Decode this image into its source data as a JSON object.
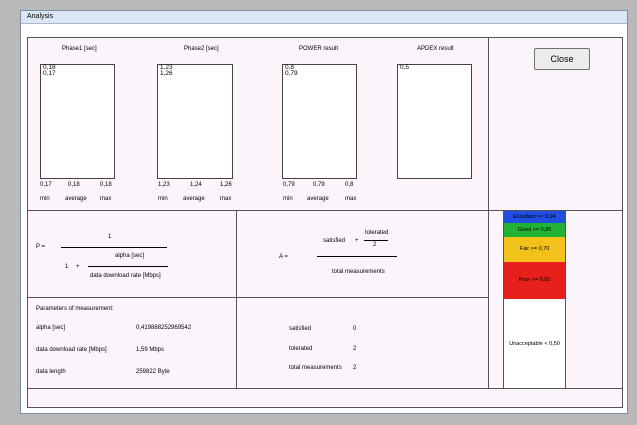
{
  "window": {
    "title": "Analysis"
  },
  "results": [
    {
      "title": "Phase1 [sec]",
      "values": [
        "0,18",
        "0,17"
      ],
      "min": "0,17",
      "average": "0,18",
      "max": "0,18"
    },
    {
      "title": "Phase2 [sec]",
      "values": [
        "1,23",
        "1,26"
      ],
      "min": "1,23",
      "average": "1,24",
      "max": "1,26"
    },
    {
      "title": "POWER result",
      "values": [
        "0,8",
        "0,79"
      ],
      "min": "0,79",
      "average": "0,79",
      "max": "0,8"
    },
    {
      "title": "APDEX result",
      "values": [
        "0,5"
      ]
    }
  ],
  "stat_labels": {
    "min": "min",
    "average": "average",
    "max": "max"
  },
  "close_label": "Close",
  "formula_p": {
    "lhs": "P =",
    "numerator": "1",
    "inner_one": "1",
    "plus": "+",
    "inner_numerator": "alpha [sec]",
    "inner_denominator": "data download rate [Mbps]"
  },
  "formula_a": {
    "lhs": "A =",
    "satisfied": "satisfied",
    "plus": "+",
    "tolerated": "tolerated",
    "two": "2",
    "denominator": "total measurements"
  },
  "parameters": {
    "title": "Parameters of measurement:",
    "rows": [
      {
        "label": "alpha [sec]",
        "value": "0,419888252969542"
      },
      {
        "label": "data download rate [Mbps]",
        "value": "1,59 Mbps"
      },
      {
        "label": "data length",
        "value": "259822 Byte"
      }
    ]
  },
  "counts": [
    {
      "label": "satisfied",
      "value": "0"
    },
    {
      "label": "tolerated",
      "value": "2"
    },
    {
      "label": "total measurements",
      "value": "2"
    }
  ],
  "apdex_scale": [
    {
      "label": "Excellent >= 0,94",
      "color": "#1f4ee0"
    },
    {
      "label": "Good >= 0,85",
      "color": "#22b233"
    },
    {
      "label": "Fair >= 0,70",
      "color": "#f2c21a"
    },
    {
      "label": "Poor >= 0,50",
      "color": "#e8201c"
    },
    {
      "label": "Unacceptable < 0,50",
      "color": "#ffffff"
    }
  ]
}
